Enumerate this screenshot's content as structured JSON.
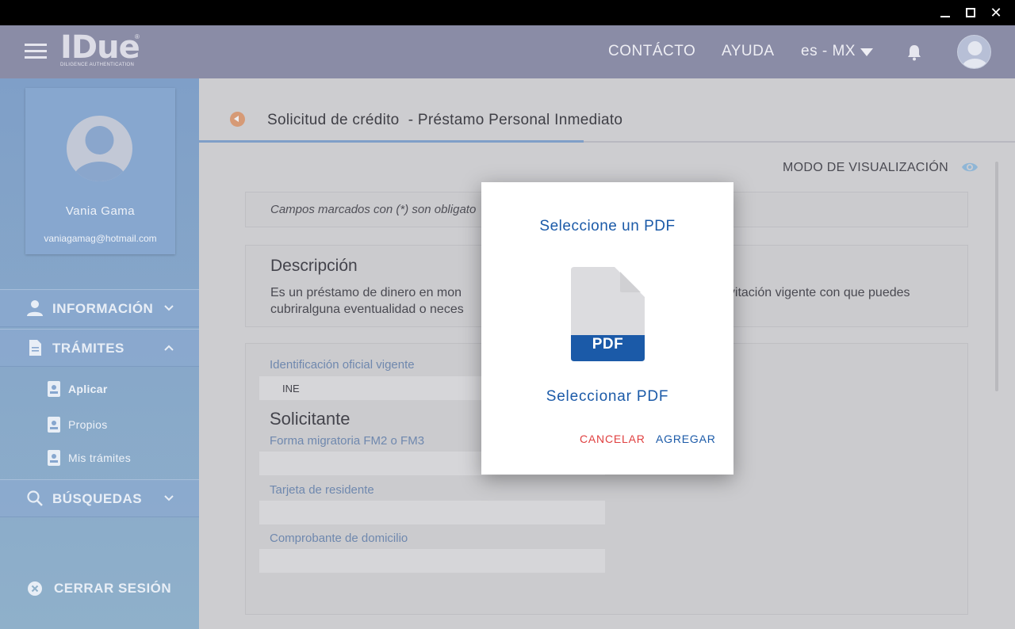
{
  "window": {
    "minimize_icon": "minimize-icon",
    "maximize_icon": "maximize-icon",
    "close_glyph": "✕"
  },
  "header": {
    "logo_text": "IDue",
    "logo_reg": "®",
    "logo_subtitle": "DILIGENCE AUTHENTICATION",
    "contact_label": "CONTÁCTO",
    "help_label": "AYUDA",
    "language_label": "es - MX"
  },
  "sidebar": {
    "profile": {
      "name": "Vania Gama",
      "email": "vaniagamag@hotmail.com"
    },
    "menu": {
      "informacion": "INFORMACIÓN",
      "tramites": "TRÁMITES",
      "busquedas": "BÚSQUEDAS"
    },
    "tramites_items": [
      "Aplicar",
      "Propios",
      "Mis trámites"
    ],
    "logout_label": "CERRAR SESIÓN"
  },
  "main": {
    "title": "Solicitud de crédito  - Préstamo Personal Inmediato",
    "view_mode_label": "MODO DE VISUALIZACIÓN",
    "required_note": "Campos marcados con (*) son obligato",
    "description_heading": "Descripción",
    "description_line1a": "Es un préstamo de dinero en mon",
    "description_line1b": "nvitación vigente con que puedes",
    "description_line2": "cubriralguna eventualidad o neces",
    "fields": {
      "id_label": "Identificación oficial vigente",
      "id_value": "INE",
      "section_solicitante": "Solicitante",
      "fm_label": "Forma migratoria FM2 o FM3",
      "residente_label": "Tarjeta de residente",
      "domicilio_label": "Comprobante de domicilio"
    }
  },
  "modal": {
    "title": "Seleccione un PDF",
    "pdf_badge": "PDF",
    "select_label": "Seleccionar PDF",
    "cancel_label": "CANCELAR",
    "add_label": "AGREGAR"
  },
  "colors": {
    "header_bg": "#8a8ca6",
    "sidebar_bg": "#7f9fc8",
    "accent_blue": "#1b5aa8",
    "cancel_red": "#e04040",
    "back_orange": "#d69a76"
  }
}
